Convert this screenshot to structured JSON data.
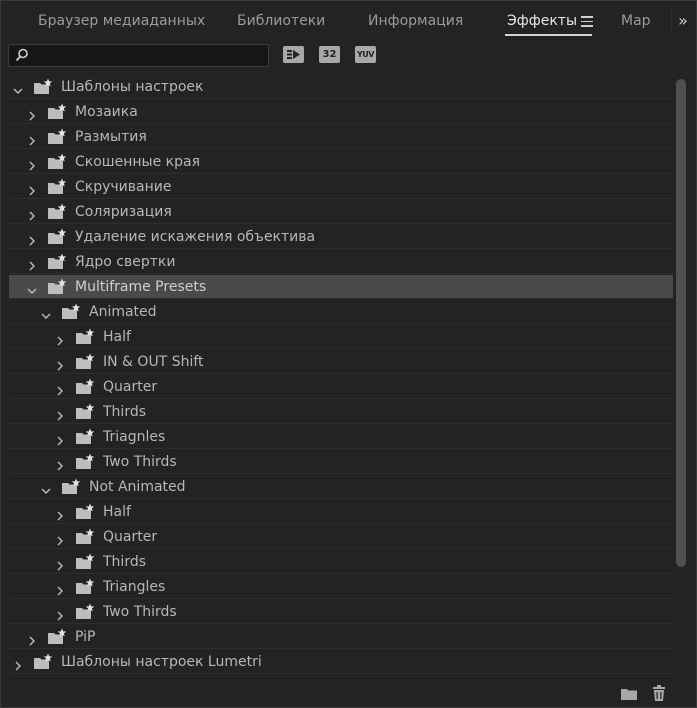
{
  "tabs": [
    {
      "label": "Браузер медиаданных",
      "active": false
    },
    {
      "label": "Библиотеки",
      "active": false
    },
    {
      "label": "Информация",
      "active": false
    },
    {
      "label": "Эффекты",
      "active": true
    },
    {
      "label": "Мар",
      "active": false
    }
  ],
  "overflow_label": "»",
  "search": {
    "value": "",
    "placeholder": ""
  },
  "toolbar": {
    "accelerated_label": "",
    "bit32_label": "32",
    "yuv_label": "YUV"
  },
  "tree": [
    {
      "label": "Шаблоны настроек",
      "depth": 0,
      "expanded": true,
      "selected": false
    },
    {
      "label": "Мозаика",
      "depth": 1,
      "expanded": false,
      "selected": false
    },
    {
      "label": "Размытия",
      "depth": 1,
      "expanded": false,
      "selected": false
    },
    {
      "label": "Скошенные края",
      "depth": 1,
      "expanded": false,
      "selected": false
    },
    {
      "label": "Скручивание",
      "depth": 1,
      "expanded": false,
      "selected": false
    },
    {
      "label": "Соляризация",
      "depth": 1,
      "expanded": false,
      "selected": false
    },
    {
      "label": "Удаление искажения объектива",
      "depth": 1,
      "expanded": false,
      "selected": false
    },
    {
      "label": "Ядро свертки",
      "depth": 1,
      "expanded": false,
      "selected": false
    },
    {
      "label": "Multiframe Presets",
      "depth": 1,
      "expanded": true,
      "selected": true
    },
    {
      "label": "Animated",
      "depth": 2,
      "expanded": true,
      "selected": false
    },
    {
      "label": "Half",
      "depth": 3,
      "expanded": false,
      "selected": false
    },
    {
      "label": "IN & OUT Shift",
      "depth": 3,
      "expanded": false,
      "selected": false
    },
    {
      "label": "Quarter",
      "depth": 3,
      "expanded": false,
      "selected": false
    },
    {
      "label": "Thirds",
      "depth": 3,
      "expanded": false,
      "selected": false
    },
    {
      "label": "Triagnles",
      "depth": 3,
      "expanded": false,
      "selected": false
    },
    {
      "label": "Two Thirds",
      "depth": 3,
      "expanded": false,
      "selected": false
    },
    {
      "label": "Not Animated",
      "depth": 2,
      "expanded": true,
      "selected": false
    },
    {
      "label": "Half",
      "depth": 3,
      "expanded": false,
      "selected": false
    },
    {
      "label": "Quarter",
      "depth": 3,
      "expanded": false,
      "selected": false
    },
    {
      "label": "Thirds",
      "depth": 3,
      "expanded": false,
      "selected": false
    },
    {
      "label": "Triangles",
      "depth": 3,
      "expanded": false,
      "selected": false
    },
    {
      "label": "Two Thirds",
      "depth": 3,
      "expanded": false,
      "selected": false
    },
    {
      "label": "PiP",
      "depth": 1,
      "expanded": false,
      "selected": false
    },
    {
      "label": "Шаблоны настроек Lumetri",
      "depth": 0,
      "expanded": false,
      "selected": false
    }
  ],
  "scrollbar": {
    "position": 0.0,
    "visible_fraction": 0.8
  },
  "colors": {
    "background": "#232323",
    "selected_row": "#4a4a4a",
    "text": "#b7b7b7"
  }
}
